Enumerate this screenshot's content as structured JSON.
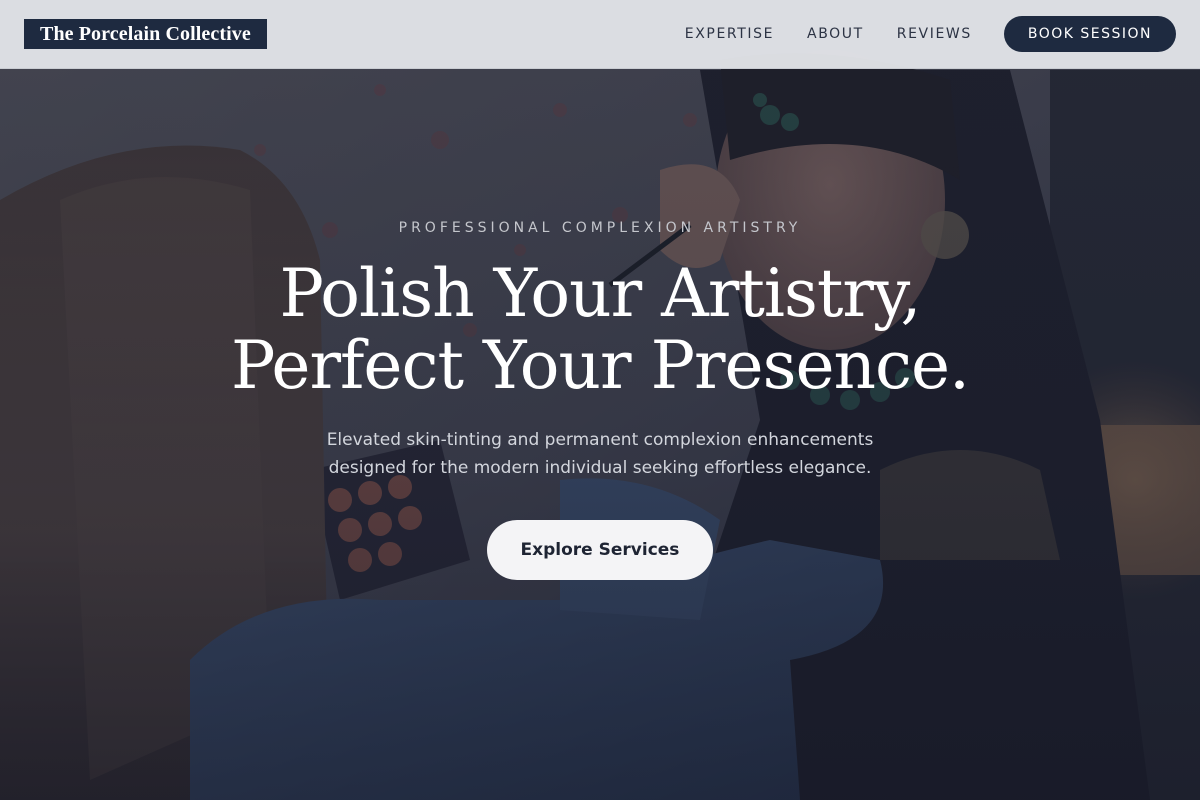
{
  "brand": {
    "name": "The Porcelain Collective"
  },
  "nav": {
    "links": [
      "EXPERTISE",
      "ABOUT",
      "REVIEWS"
    ],
    "cta_label": "BOOK SESSION"
  },
  "hero": {
    "eyebrow": "PROFESSIONAL COMPLEXION ARTISTRY",
    "headline_line1": "Polish Your Artistry,",
    "headline_line2": "Perfect Your Presence.",
    "subtext": "Elevated skin-tinting and permanent complexion enhancements designed for the modern individual seeking effortless elegance.",
    "cta_label": "Explore Services"
  },
  "colors": {
    "brand_dark": "#1e2a40",
    "navbar_bg": "#e2e4e8",
    "cta_bg": "#f4f4f6",
    "overlay": "#1c2233"
  }
}
